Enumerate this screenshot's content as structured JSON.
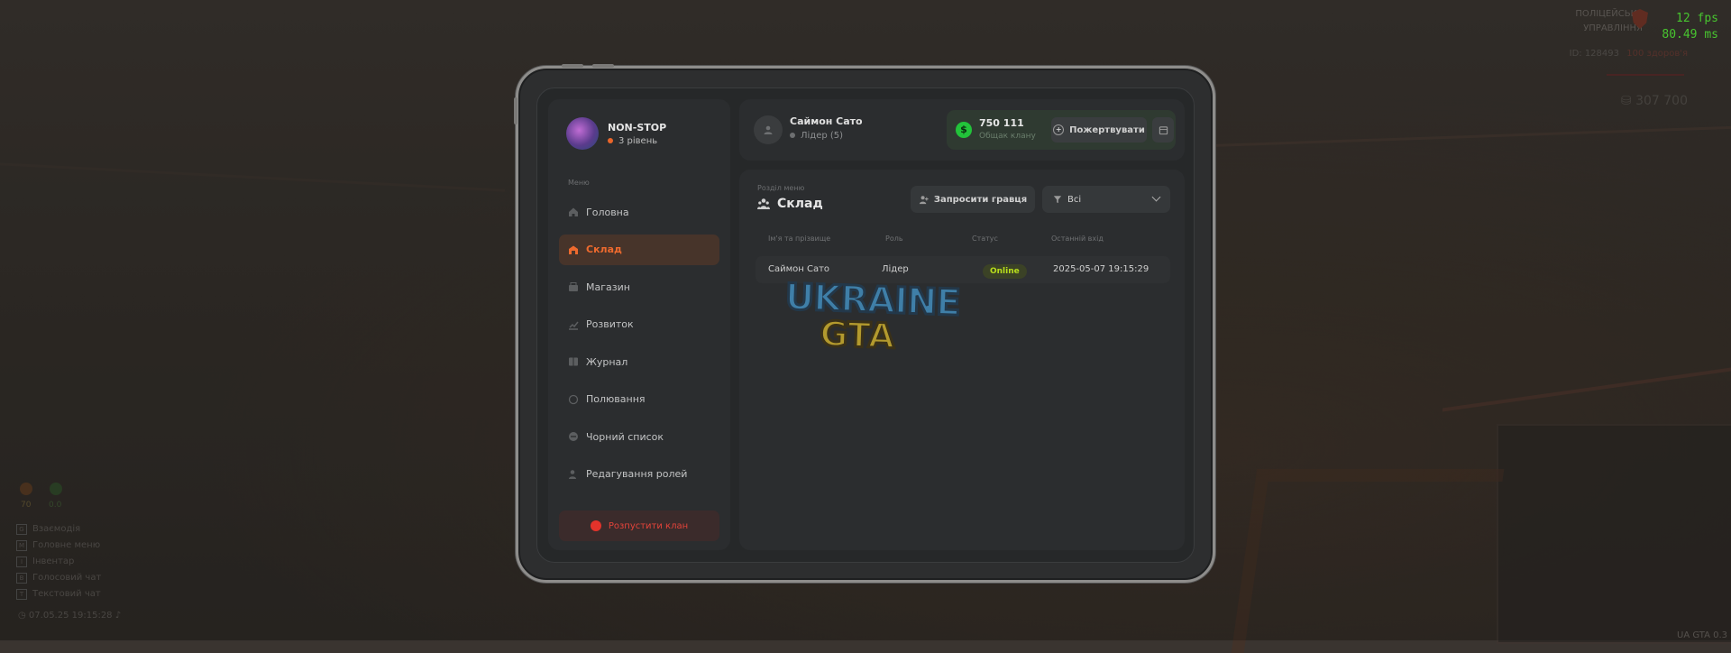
{
  "hud": {
    "fps": "12 fps",
    "ms": "80.49 ms",
    "top_right_1": "ПОЛІЦЕЙСЬКЕ",
    "top_right_2": "УПРАВЛІННЯ",
    "id_line": "ID: 128493",
    "health": "100 здоров'я",
    "money": "307 700",
    "date_time": "07.05.25 19:15:28",
    "level_a": "70",
    "level_b": "0.0",
    "version": "UA GTA 0.3"
  },
  "controls": [
    {
      "key": "G",
      "label": "Взаємодія"
    },
    {
      "key": "M",
      "label": "Головне меню"
    },
    {
      "key": "I",
      "label": "Інвентар"
    },
    {
      "key": "B",
      "label": "Голосовий чат"
    },
    {
      "key": "T",
      "label": "Текстовий чат"
    }
  ],
  "clan": {
    "name": "NON-STOP",
    "level": "3 рівень"
  },
  "menu": {
    "title": "Меню",
    "items": [
      {
        "label": "Головна",
        "icon": "home-icon",
        "active": false
      },
      {
        "label": "Склад",
        "icon": "warehouse-icon",
        "active": true
      },
      {
        "label": "Магазин",
        "icon": "shop-icon",
        "active": false
      },
      {
        "label": "Розвиток",
        "icon": "growth-icon",
        "active": false
      },
      {
        "label": "Журнал",
        "icon": "journal-icon",
        "active": false
      },
      {
        "label": "Полювання",
        "icon": "target-icon",
        "active": false
      },
      {
        "label": "Чорний список",
        "icon": "ban-icon",
        "active": false
      },
      {
        "label": "Редагування ролей",
        "icon": "role-edit-icon",
        "active": false
      }
    ],
    "disband": "Розпустити клан"
  },
  "header": {
    "user_name": "Саймон Сато",
    "user_role": "Лідер (5)",
    "funds_value": "750 111",
    "funds_label": "Общак клану",
    "donate": "Пожертвувати"
  },
  "section": {
    "label": "Розділ меню",
    "title": "Склад",
    "invite": "Запросити гравця",
    "filter": "Всі"
  },
  "table": {
    "headers": [
      "Ім'я та прізвище",
      "Роль",
      "Статус",
      "Останній вхід"
    ],
    "rows": [
      {
        "name": "Саймон Сато",
        "role": "Лідер",
        "status": "Online",
        "last": "2025-05-07 19:15:29"
      }
    ]
  },
  "watermark": {
    "line1": "UKRAINE",
    "line2": "GTA"
  },
  "colors": {
    "accent": "#ee6a2e",
    "online": "#b8de1c",
    "danger": "#e2332b",
    "funds": "#22c33a"
  }
}
